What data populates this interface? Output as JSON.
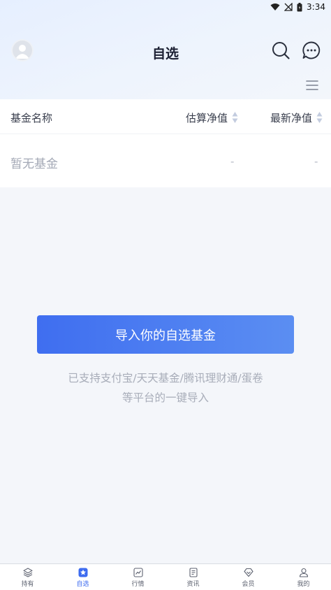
{
  "status_bar": {
    "time": "3:34"
  },
  "header": {
    "title": "自选"
  },
  "table": {
    "col_name": "基金名称",
    "col_estimate": "估算净值",
    "col_latest": "最新净值",
    "empty_name": "暂无基金",
    "empty_estimate": "-",
    "empty_latest": "-"
  },
  "import": {
    "button_label": "导入你的自选基金",
    "support_line1": "已支持支付宝/天天基金/腾讯理财通/蛋卷",
    "support_line2": "等平台的一键导入"
  },
  "tabs": [
    {
      "label": "持有",
      "icon": "layers-icon"
    },
    {
      "label": "自选",
      "icon": "star-icon"
    },
    {
      "label": "行情",
      "icon": "chart-icon"
    },
    {
      "label": "资讯",
      "icon": "document-icon"
    },
    {
      "label": "会员",
      "icon": "diamond-icon"
    },
    {
      "label": "我的",
      "icon": "person-icon"
    }
  ],
  "colors": {
    "accent": "#3d6bef",
    "button_start": "#3f6ef0",
    "button_end": "#5b8ef2"
  }
}
